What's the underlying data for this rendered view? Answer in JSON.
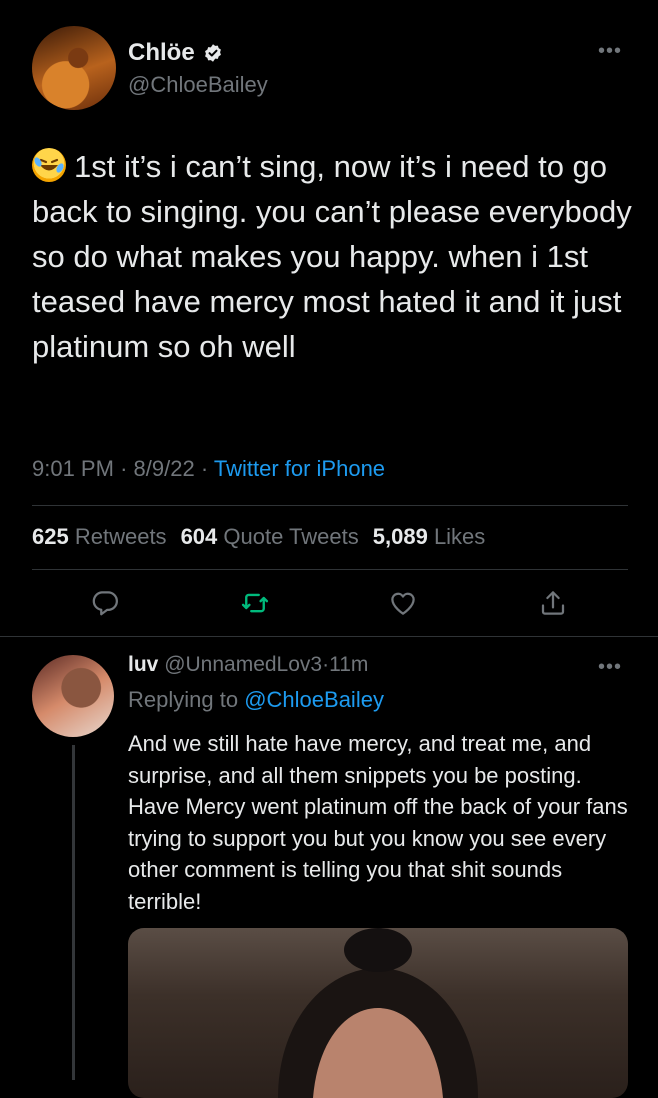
{
  "tweet": {
    "display_name": "Chlöe",
    "handle": "@ChloeBailey",
    "more_label": "•••",
    "emoji": "rolling-on-the-floor-laughing",
    "text": "1st it’s i can’t sing, now it’s i need to go back to singing. you can’t please everybody so do what makes you happy. when i 1st teased have mercy most hated it and it just platinum so oh well",
    "time": "9:01 PM",
    "date": "8/9/22",
    "source": "Twitter for iPhone",
    "separator": "·",
    "stats": {
      "retweets_count": "625",
      "retweets_label": "Retweets",
      "quotes_count": "604",
      "quotes_label": "Quote Tweets",
      "likes_count": "5,089",
      "likes_label": "Likes"
    }
  },
  "actions": [
    {
      "name": "reply-icon"
    },
    {
      "name": "retweet-icon"
    },
    {
      "name": "like-icon"
    },
    {
      "name": "share-icon"
    }
  ],
  "reply": {
    "display_name": "luv",
    "handle": "@UnnamedLov3",
    "age": "11m",
    "more_label": "•••",
    "replying_prefix": "Replying to",
    "replying_to": "@ChloeBailey",
    "text": "And we still hate have mercy, and treat me, and surprise, and all them snippets you be posting. Have Mercy went platinum off the back of your fans trying to support you but you know you see every other comment is telling you that shit sounds terrible!"
  },
  "colors": {
    "background": "#000000",
    "text": "#e7e9ea",
    "muted": "#71767b",
    "link": "#1d9bf0",
    "retweet_green": "#00ba7c",
    "divider": "#2f3336"
  }
}
